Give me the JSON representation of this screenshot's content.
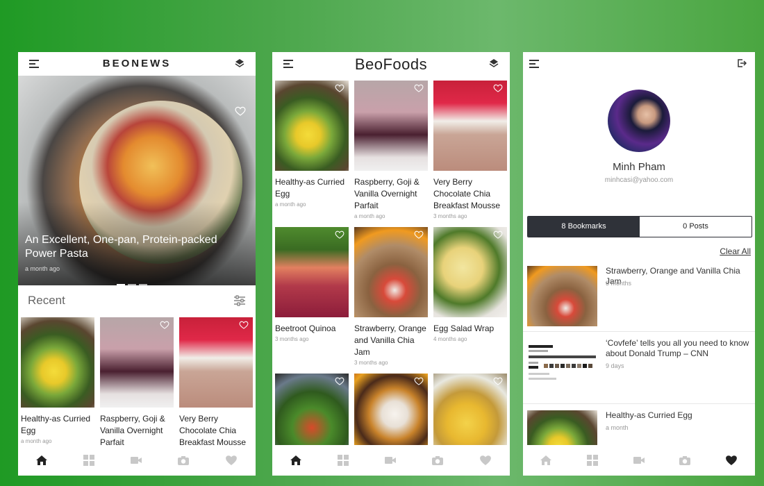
{
  "screens": {
    "news": {
      "logo": "BEONEWS",
      "hero": {
        "title": "An Excellent, One-pan, Protein-packed Power Pasta",
        "time": "a month ago"
      },
      "section_title": "Recent",
      "cards": [
        {
          "name": "Healthy-as Curried Egg",
          "time": "a month ago"
        },
        {
          "name": "Raspberry, Goji & Vanilla Overnight Parfait",
          "time": ""
        },
        {
          "name": "Very Berry Chocolate Chia Breakfast Mousse",
          "time": ""
        }
      ]
    },
    "foods": {
      "logo": "BeoFoods",
      "cards": [
        {
          "name": "Healthy-as Curried Egg",
          "time": "a month ago"
        },
        {
          "name": "Raspberry, Goji & Vanilla Overnight Parfait",
          "time": "a month ago"
        },
        {
          "name": "Very Berry Chocolate Chia Breakfast Mousse",
          "time": "3 months ago"
        },
        {
          "name": "Beetroot Quinoa",
          "time": "3 months ago"
        },
        {
          "name": "Strawberry, Orange and Vanilla Chia Jam",
          "time": "3 months ago"
        },
        {
          "name": "Egg Salad Wrap",
          "time": "4 months ago"
        }
      ]
    },
    "profile": {
      "name": "Minh Pham",
      "email": "minhcasi@yahoo.com",
      "tabs": {
        "bookmarks": "8 Bookmarks",
        "posts": "0 Posts"
      },
      "clear_all": "Clear All",
      "bookmarks": [
        {
          "title": "Strawberry, Orange and Vanilla Chia Jam",
          "time": "3 months"
        },
        {
          "title": "‘Covfefe’ tells you all you need to know about Donald Trump – CNN",
          "time": "9 days"
        },
        {
          "title": "Healthy-as Curried Egg",
          "time": "a month"
        }
      ]
    }
  },
  "icons": [
    "menu-icon",
    "layers-icon",
    "heart-icon",
    "filter-icon",
    "home-icon",
    "grid-icon",
    "video-icon",
    "camera-icon",
    "logout-icon"
  ],
  "colors": {
    "tab_active": "#222222",
    "tab_inactive": "#c8c8c8",
    "segment_active": "#2f3239"
  }
}
